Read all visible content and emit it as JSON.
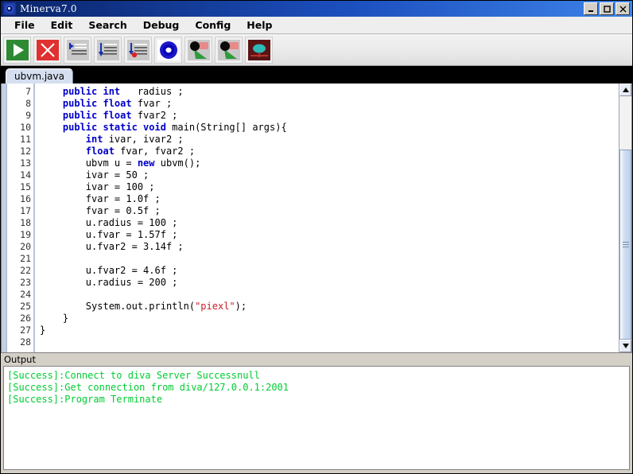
{
  "window": {
    "title": "Minerva7.0",
    "app_icon": "disc-icon",
    "controls": [
      {
        "name": "minimize-button",
        "label": "_"
      },
      {
        "name": "maximize-button",
        "label": "□"
      },
      {
        "name": "close-button",
        "label": "✕"
      }
    ]
  },
  "menubar": {
    "items": [
      {
        "label": "File"
      },
      {
        "label": "Edit"
      },
      {
        "label": "Search"
      },
      {
        "label": "Debug"
      },
      {
        "label": "Config"
      },
      {
        "label": "Help"
      }
    ]
  },
  "toolbar": {
    "buttons": [
      {
        "name": "run-button",
        "icon": "play-icon"
      },
      {
        "name": "stop-button",
        "icon": "stop-x-icon"
      },
      {
        "name": "step-into-button",
        "icon": "step-into-icon"
      },
      {
        "name": "step-over-button",
        "icon": "step-over-icon"
      },
      {
        "name": "run-to-breakpoint-button",
        "icon": "step-breakpoint-icon"
      },
      {
        "name": "breakpoint-button",
        "icon": "blue-disc-icon"
      },
      {
        "name": "watch-button",
        "icon": "magnifier-green-icon"
      },
      {
        "name": "inspect-button",
        "icon": "magnifier-green-alt-icon"
      },
      {
        "name": "memory-view-button",
        "icon": "memory-chip-icon"
      }
    ]
  },
  "tabs": [
    {
      "label": "ubvm.java",
      "active": true
    }
  ],
  "editor": {
    "first_line": 7,
    "breakpoint_line": 18,
    "lines": [
      {
        "n": 7,
        "tokens": [
          {
            "t": "    ",
            "k": "p"
          },
          {
            "t": "public int",
            "k": "kw"
          },
          {
            "t": "   radius ;",
            "k": "p"
          }
        ]
      },
      {
        "n": 8,
        "tokens": [
          {
            "t": "    ",
            "k": "p"
          },
          {
            "t": "public float",
            "k": "kw"
          },
          {
            "t": " fvar ;",
            "k": "p"
          }
        ]
      },
      {
        "n": 9,
        "tokens": [
          {
            "t": "    ",
            "k": "p"
          },
          {
            "t": "public float",
            "k": "kw"
          },
          {
            "t": " fvar2 ;",
            "k": "p"
          }
        ]
      },
      {
        "n": 10,
        "tokens": [
          {
            "t": "    ",
            "k": "p"
          },
          {
            "t": "public static void",
            "k": "kw"
          },
          {
            "t": " main(String[] args){",
            "k": "p"
          }
        ]
      },
      {
        "n": 11,
        "tokens": [
          {
            "t": "        ",
            "k": "p"
          },
          {
            "t": "int",
            "k": "kw"
          },
          {
            "t": " ivar, ivar2 ;",
            "k": "p"
          }
        ]
      },
      {
        "n": 12,
        "tokens": [
          {
            "t": "        ",
            "k": "p"
          },
          {
            "t": "float",
            "k": "kw"
          },
          {
            "t": " fvar, fvar2 ;",
            "k": "p"
          }
        ]
      },
      {
        "n": 13,
        "tokens": [
          {
            "t": "        ubvm u = ",
            "k": "p"
          },
          {
            "t": "new",
            "k": "kw"
          },
          {
            "t": " ubvm();",
            "k": "p"
          }
        ]
      },
      {
        "n": 14,
        "tokens": [
          {
            "t": "        ivar = 50 ;",
            "k": "p"
          }
        ]
      },
      {
        "n": 15,
        "tokens": [
          {
            "t": "        ivar = 100 ;",
            "k": "p"
          }
        ]
      },
      {
        "n": 16,
        "tokens": [
          {
            "t": "        fvar = 1.0f ;",
            "k": "p"
          }
        ]
      },
      {
        "n": 17,
        "tokens": [
          {
            "t": "        fvar = 0.5f ;",
            "k": "p"
          }
        ]
      },
      {
        "n": 18,
        "tokens": [
          {
            "t": "        u.radius = 100 ;",
            "k": "p"
          }
        ]
      },
      {
        "n": 19,
        "tokens": [
          {
            "t": "        u.fvar = 1.57f ;",
            "k": "p"
          }
        ]
      },
      {
        "n": 20,
        "tokens": [
          {
            "t": "        u.fvar2 = 3.14f ;",
            "k": "p"
          }
        ]
      },
      {
        "n": 21,
        "tokens": [
          {
            "t": "",
            "k": "p"
          }
        ]
      },
      {
        "n": 22,
        "tokens": [
          {
            "t": "        u.fvar2 = 4.6f ;",
            "k": "p"
          }
        ]
      },
      {
        "n": 23,
        "tokens": [
          {
            "t": "        u.radius = 200 ;",
            "k": "p"
          }
        ]
      },
      {
        "n": 24,
        "tokens": [
          {
            "t": "",
            "k": "p"
          }
        ]
      },
      {
        "n": 25,
        "tokens": [
          {
            "t": "        System.out.println(",
            "k": "p"
          },
          {
            "t": "\"piexl\"",
            "k": "str"
          },
          {
            "t": ");",
            "k": "p"
          }
        ]
      },
      {
        "n": 26,
        "tokens": [
          {
            "t": "    }",
            "k": "p"
          }
        ]
      },
      {
        "n": 27,
        "tokens": [
          {
            "t": "}",
            "k": "p"
          }
        ]
      },
      {
        "n": 28,
        "tokens": [
          {
            "t": "",
            "k": "p"
          }
        ]
      }
    ]
  },
  "scrollbar": {
    "up_arrow": "caret-up-icon",
    "down_arrow": "caret-down-icon",
    "thumb_top_pct": 22,
    "thumb_height_pct": 78
  },
  "output": {
    "label": "Output",
    "lines": [
      "[Success]:Connect to diva Server Successnull",
      "[Success]:Get connection from diva/127.0.0.1:2001",
      "[Success]:Program Terminate"
    ]
  },
  "colors": {
    "title_bar": "#0a246a",
    "keyword": "#0000c8",
    "string": "#c81e28",
    "output_text": "#00cc33",
    "breakpoint": "#f01010",
    "tab_active": "#d6dff0"
  }
}
